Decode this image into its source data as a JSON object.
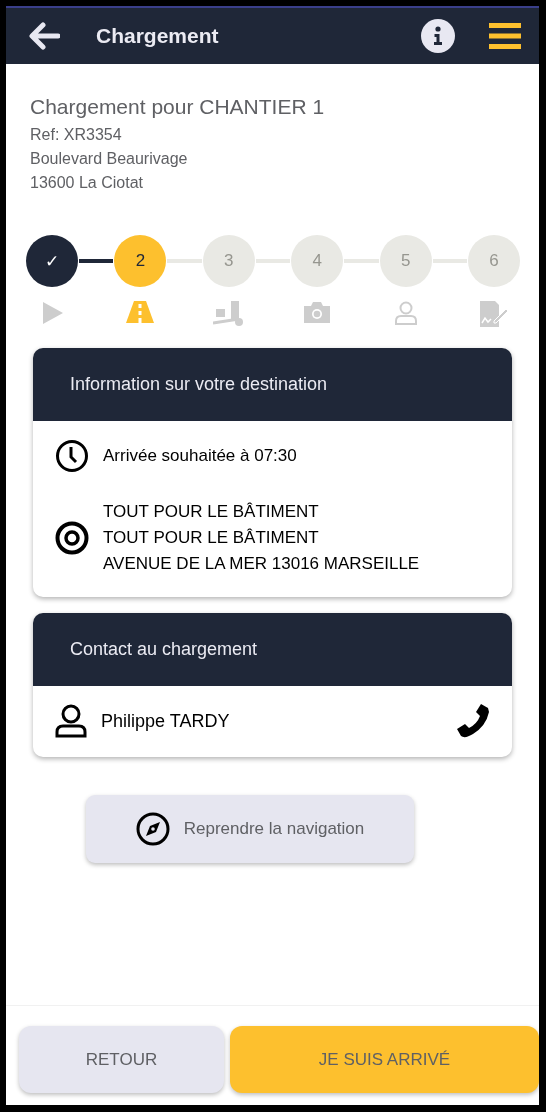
{
  "header": {
    "title": "Chargement"
  },
  "summary": {
    "title": "Chargement pour CHANTIER 1",
    "lines": [
      "Ref: XR3354",
      "Boulevard Beaurivage",
      "13600 La Ciotat"
    ]
  },
  "steps": [
    {
      "label": "✓",
      "completed": true,
      "selected": false,
      "kind": "play"
    },
    {
      "label": "2",
      "completed": false,
      "selected": true,
      "kind": "road"
    },
    {
      "label": "3",
      "completed": false,
      "selected": false,
      "kind": "loading"
    },
    {
      "label": "4",
      "completed": false,
      "selected": false,
      "kind": "camera"
    },
    {
      "label": "5",
      "completed": false,
      "selected": false,
      "kind": "person"
    },
    {
      "label": "6",
      "completed": false,
      "selected": false,
      "kind": "signature"
    }
  ],
  "destination": {
    "title": "Information sur votre destination",
    "rows": [
      {
        "kind": "clock",
        "lines": [
          "Arrivée souhaitée à 07:30"
        ]
      },
      {
        "kind": "target",
        "lines": [
          "TOUT POUR LE BÂTIMENT",
          "TOUT POUR LE BÂTIMENT",
          "AVENUE DE LA MER 13016 MARSEILLE"
        ]
      }
    ]
  },
  "contact": {
    "title": "Contact au chargement",
    "name": "Philippe TARDY"
  },
  "navigation_button": "Reprendre la navigation",
  "footer": {
    "back": "RETOUR",
    "arrived": "JE SUIS ARRIVÉ"
  }
}
